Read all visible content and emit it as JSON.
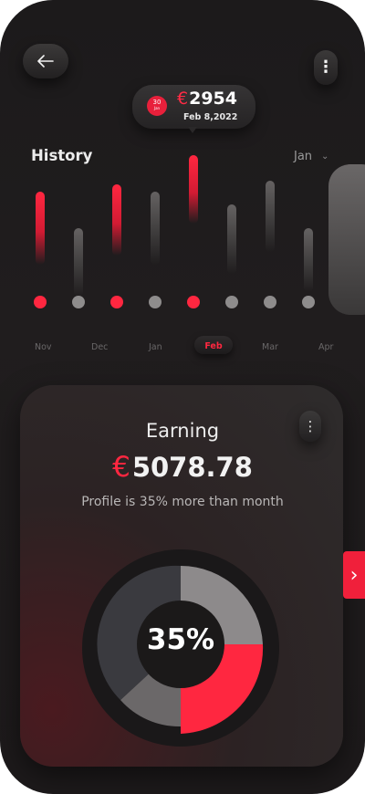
{
  "header": {
    "back_icon": "arrow-left-icon",
    "menu_icon": "more-vertical-icon",
    "menu_glyph": "⋮"
  },
  "tooltip": {
    "day_number": "30",
    "day_sub": "Jan",
    "currency": "€",
    "amount": "2954",
    "date": "Feb 8,2022"
  },
  "history": {
    "title": "History",
    "month_selected": "Jan",
    "chevron": "⌄",
    "accent_color": "#ff2740",
    "months": [
      "Nov",
      "Dec",
      "Jan",
      "Feb",
      "Mar",
      "Apr"
    ],
    "active_month": "Feb"
  },
  "earning": {
    "title": "Earning",
    "currency": "€",
    "amount": "5078.78",
    "subtitle": "Profile is 35% more than month",
    "menu_glyph": "⋮",
    "percent_label": "35%",
    "percent_value": 35,
    "next_glyph": "›"
  }
}
